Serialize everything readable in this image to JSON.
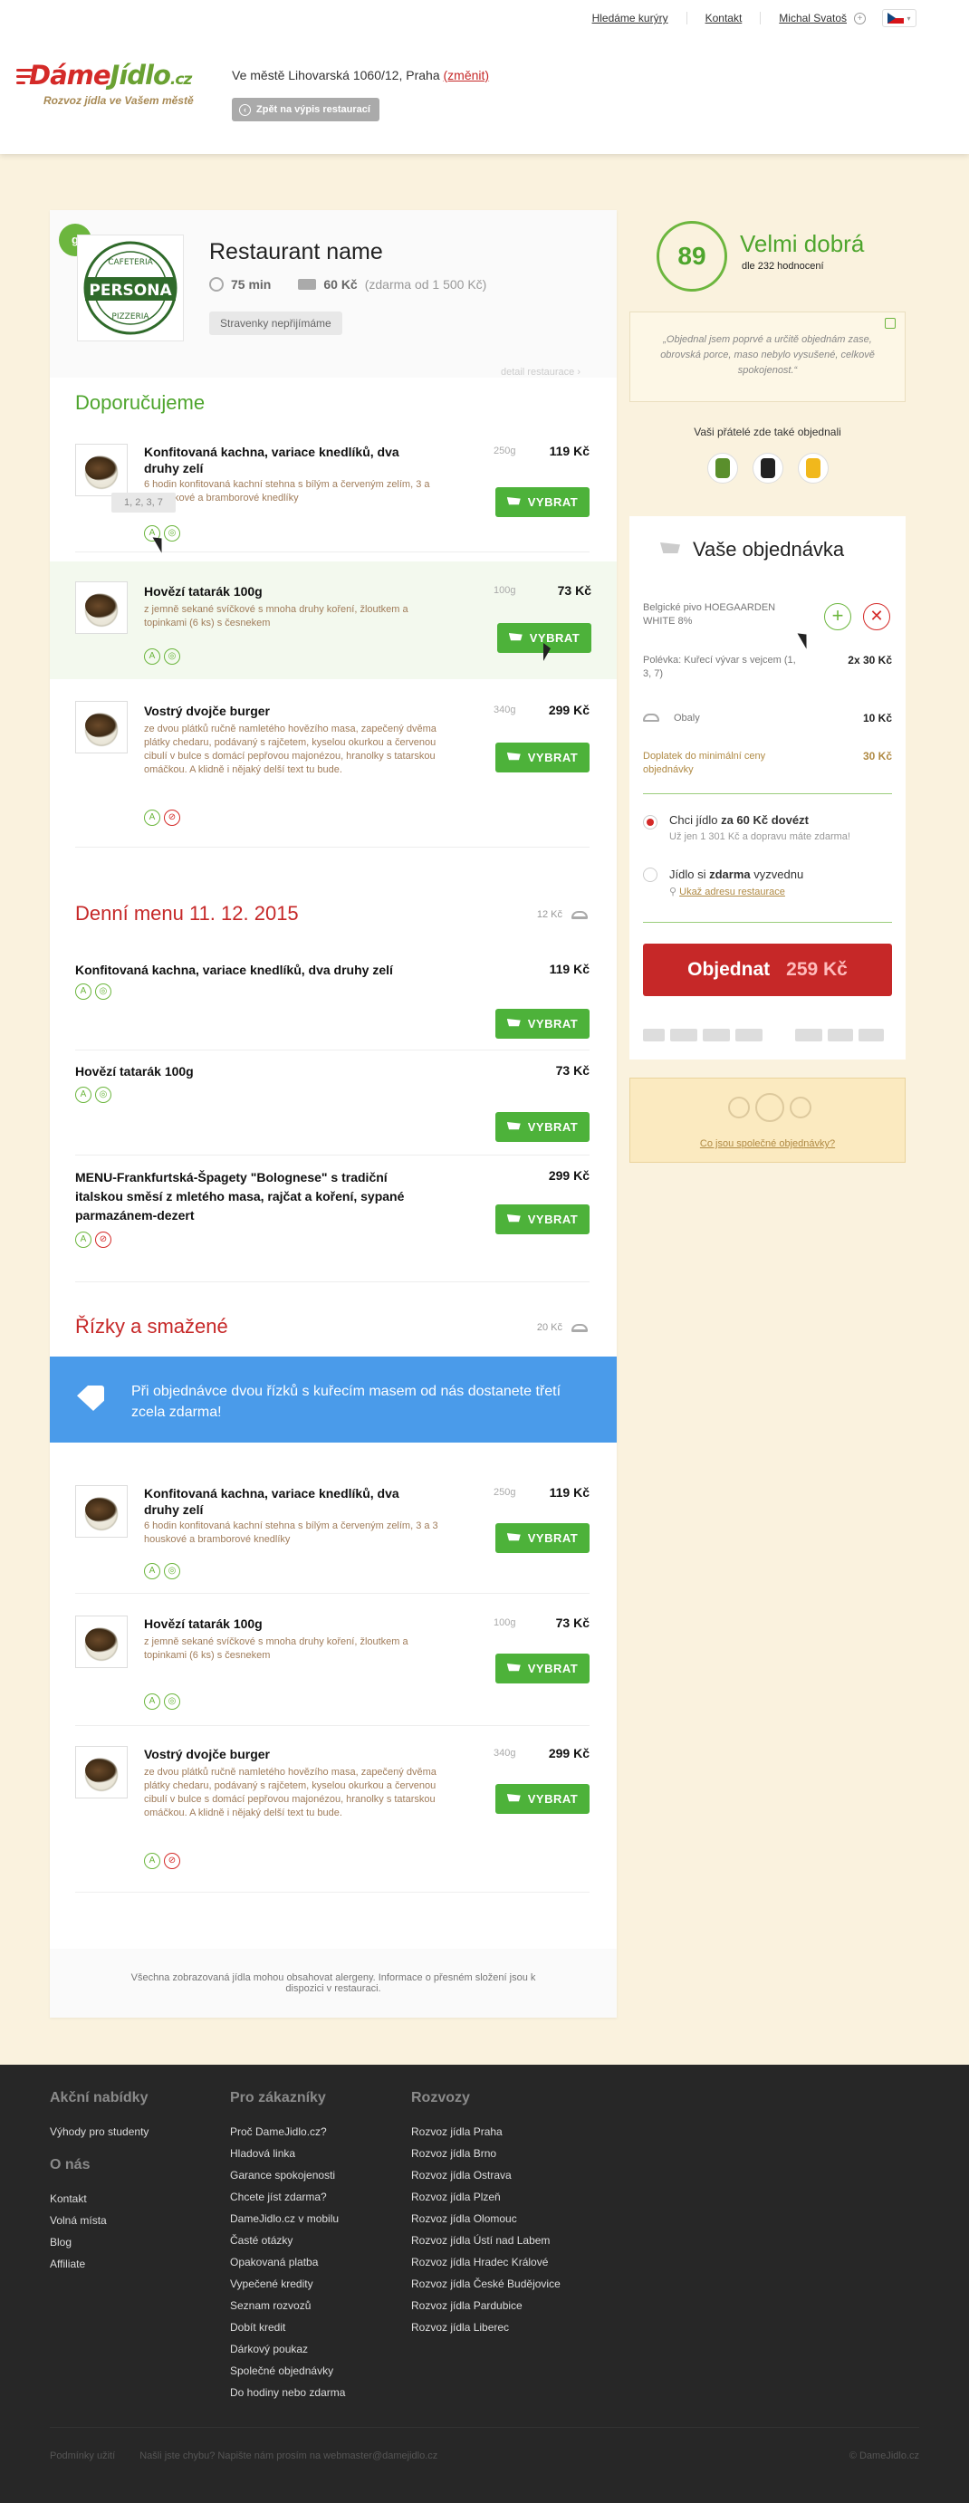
{
  "topnav": {
    "links": [
      "Hledáme kurýry",
      "Kontakt",
      "Michal Svatoš"
    ]
  },
  "logo": {
    "text_a": "Dáme",
    "text_b": "Jídlo",
    "text_tld": ".cz",
    "tagline": "Rozvoz jídla ve Vašem městě"
  },
  "address": {
    "prefix": "Ve městě",
    "value": "Lihovarská 1060/12, Praha",
    "change": "(změnit)"
  },
  "back_button": "Zpět na výpis restaurací",
  "restaurant": {
    "name": "Restaurant name",
    "badge": "g",
    "logo_text": "PERSONA",
    "logo_top": "CAFETERIA",
    "logo_bottom": "PIZZERIA",
    "time": "75 min",
    "delivery_price": "60 Kč",
    "delivery_note": "(zdarma od 1 500 Kč)",
    "vouchers": "Stravenky nepřijímáme",
    "detail_link": "detail restaurace ›"
  },
  "sections": {
    "recommended": {
      "title": "Doporučujeme",
      "items": [
        {
          "name": "Konfitovaná kachna, variace knedlíků, dva druhy zelí",
          "desc": "6 hodin konfitovaná kachní stehna s bílým a červeným zelím, 3 a 3 houskové a bramborové knedlíky",
          "weight": "250g",
          "price": "119 Kč",
          "button": "VYBRAT"
        },
        {
          "name": "Hovězí tatarák 100g",
          "desc": "z jemně sekané svíčkové s mnoha druhy koření, žloutkem a topinkami (6 ks) s česnekem",
          "weight": "100g",
          "price": "73 Kč",
          "button": "VYBRAT"
        },
        {
          "name": "Vostrý dvojče burger",
          "desc": "ze dvou plátků ručně namletého hovězího masa, zapečený dvěma plátky chedaru, podávaný s rajčetem, kyselou okurkou a červenou cibulí v bulce s domácí pepřovou majonézou, hranolky s tatarskou omáčkou. A klidně i nějaký delší text tu bude.",
          "weight": "340g",
          "price": "299 Kč",
          "button": "VYBRAT"
        }
      ],
      "tooltip": "1, 2, 3, 7"
    },
    "daily": {
      "title": "Denní menu 11. 12. 2015",
      "box_price": "12 Kč",
      "items": [
        {
          "name": "Konfitovaná kachna, variace knedlíků, dva druhy zelí",
          "price": "119 Kč",
          "button": "VYBRAT"
        },
        {
          "name": "Hovězí tatarák 100g",
          "price": "73 Kč",
          "button": "VYBRAT"
        },
        {
          "name": "MENU-Frankfurtská-Špagety \"Bolognese\" s tradiční italskou směsí z mletého masa, rajčat a koření, sypané parmazánem-dezert",
          "price": "299 Kč",
          "button": "VYBRAT"
        }
      ]
    },
    "fried": {
      "title": "Řízky a smažené",
      "box_price": "20 Kč",
      "promo": "Při objednávce dvou řízků s kuřecím masem od nás dostanete třetí zcela zdarma!",
      "items": [
        {
          "name": "Konfitovaná kachna, variace knedlíků, dva druhy zelí",
          "desc": "6 hodin konfitovaná kachní stehna s bílým a červeným zelím, 3 a 3 houskové a bramborové knedlíky",
          "weight": "250g",
          "price": "119 Kč",
          "button": "VYBRAT"
        },
        {
          "name": "Hovězí tatarák 100g",
          "desc": "z jemně sekané svíčkové s mnoha druhy koření, žloutkem a topinkami (6 ks) s česnekem",
          "weight": "100g",
          "price": "73 Kč",
          "button": "VYBRAT"
        },
        {
          "name": "Vostrý dvojče burger",
          "desc": "ze dvou plátků ručně namletého hovězího masa, zapečený dvěma plátky chedaru, podávaný s rajčetem, kyselou okurkou a červenou cibulí v bulce s domácí pepřovou majonézou, hranolky s tatarskou omáčkou. A klidně i nějaký delší text tu bude.",
          "weight": "340g",
          "price": "299 Kč",
          "button": "VYBRAT"
        }
      ]
    }
  },
  "allergens_note": "Všechna zobrazovaná jídla mohou obsahovat alergeny. Informace o přesném složení jsou k dispozici v restauraci.",
  "rating": {
    "score": "89",
    "label": "Velmi dobrá",
    "count": "dle 232 hodnocení"
  },
  "quote": "„Objednal jsem poprvé a určitě objednám zase, obrovská porce, maso nebylo vysušené, celkově spokojenost.“",
  "friends_title": "Vaši přátelé zde také objednali",
  "order": {
    "title": "Vaše objednávka",
    "items": [
      {
        "name": "Belgické pivo HOEGAARDEN WHITE 8%"
      },
      {
        "name": "Polévka: Kuřecí vývar s vejcem (1, 3, 7)",
        "price": "2x 30 Kč"
      },
      {
        "name": "Obaly",
        "price": "10 Kč"
      },
      {
        "name": "Doplatek do minimální ceny objednávky",
        "price": "30 Kč"
      }
    ],
    "delivery_label_a": "Chci jídlo",
    "delivery_label_b": "za 60 Kč dovézt",
    "delivery_sub": "Už jen 1 301 Kč a dopravu máte zdarma!",
    "pickup_label_a": "Jídlo si",
    "pickup_label_b": "zdarma",
    "pickup_label_c": "vyzvednu",
    "pickup_link": "Ukaž adresu restaurace",
    "submit": "Objednat",
    "total": "259 Kč"
  },
  "shared_orders": "Co jsou společné objednávky?",
  "footer": {
    "col1": {
      "h1": "Akční nabídky",
      "l1": [
        "Výhody pro studenty"
      ],
      "h2": "O nás",
      "l2": [
        "Kontakt",
        "Volná místa",
        "Blog",
        "Affiliate"
      ]
    },
    "col2": {
      "h": "Pro zákazníky",
      "links": [
        "Proč DameJidlo.cz?",
        "Hladová linka",
        "Garance spokojenosti",
        "Chcete jíst zdarma?",
        "DameJidlo.cz v mobilu",
        "Časté otázky",
        "Opakovaná platba",
        "Vypečené kredity",
        "Seznam rozvozů",
        "Dobít kredit",
        "Dárkový poukaz",
        "Společné objednávky",
        "Do hodiny nebo zdarma"
      ]
    },
    "col3": {
      "h": "Rozvozy",
      "links": [
        "Rozvoz jídla Praha",
        "Rozvoz jídla Brno",
        "Rozvoz jídla Ostrava",
        "Rozvoz jídla Plzeň",
        "Rozvoz jídla Olomouc",
        "Rozvoz jídla Ústí nad Labem",
        "Rozvoz jídla Hradec Králové",
        "Rozvoz jídla České Budějovice",
        "Rozvoz jídla Pardubice",
        "Rozvoz jídla Liberec"
      ]
    },
    "bottom": {
      "terms": "Podmínky užití",
      "error": "Našli jste chybu? Napište nám prosím na webmaster@damejidlo.cz",
      "copy": "© DameJidlo.cz"
    }
  },
  "colors": {
    "green": "#4db23a",
    "red": "#c62828",
    "blue": "#4a9bea",
    "cream": "#faf2de",
    "footer": "#272727"
  }
}
